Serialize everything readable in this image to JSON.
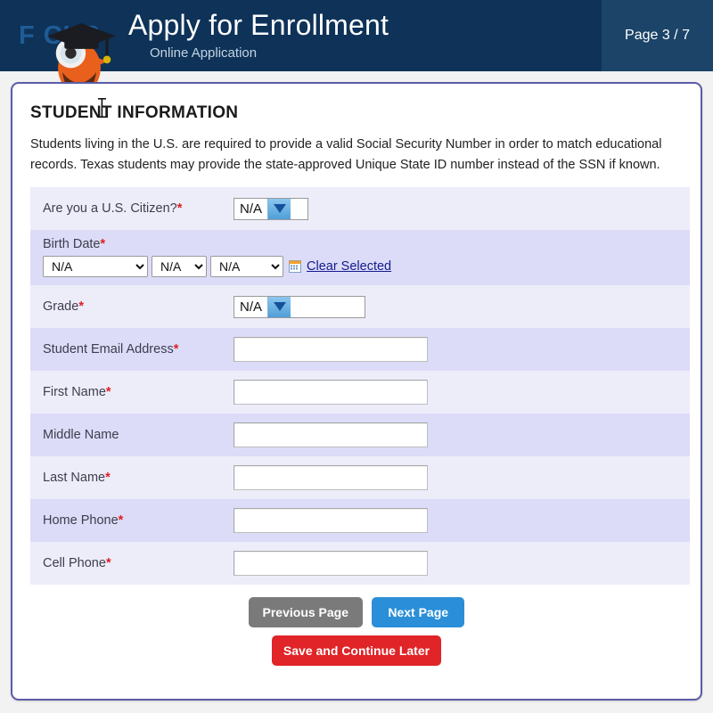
{
  "header": {
    "logo_text": "F CUS",
    "logo_icon": "focus-bird-graduate-logo",
    "title": "Apply for Enrollment",
    "subtitle": "Online Application",
    "page_indicator": "Page 3 / 7",
    "bg_color": "#0e3258",
    "panel_color": "#1b4468"
  },
  "card": {
    "section_title": "STUDENT INFORMATION",
    "intro": "Students living in the U.S. are required to provide a valid Social Security Number in order to match educational records. Texas students may provide the state-approved Unique State ID number instead of the SSN if known.",
    "border_color": "#5c5ca8"
  },
  "form": {
    "citizen": {
      "label": "Are you a U.S. Citizen?",
      "required": "*",
      "value": "N/A"
    },
    "birth_date": {
      "label": "Birth Date",
      "required": "*",
      "month": "N/A",
      "day": "N/A",
      "year": "N/A",
      "calendar_icon": "calendar-icon",
      "clear_link": "Clear Selected"
    },
    "grade": {
      "label": "Grade",
      "required": "*",
      "value": "N/A"
    },
    "email": {
      "label": "Student Email Address",
      "required": "*",
      "value": ""
    },
    "first_name": {
      "label": "First Name",
      "required": "*",
      "value": ""
    },
    "middle_name": {
      "label": "Middle Name",
      "required": "",
      "value": ""
    },
    "last_name": {
      "label": "Last Name",
      "required": "*",
      "value": ""
    },
    "home_phone": {
      "label": "Home Phone",
      "required": "*",
      "value": ""
    },
    "cell_phone": {
      "label": "Cell Phone",
      "required": "*",
      "value": ""
    }
  },
  "buttons": {
    "previous": "Previous Page",
    "next": "Next Page",
    "save": "Save and Continue Later",
    "previous_color": "#7a7a7a",
    "next_color": "#2a8fd8",
    "save_color": "#e02427"
  }
}
